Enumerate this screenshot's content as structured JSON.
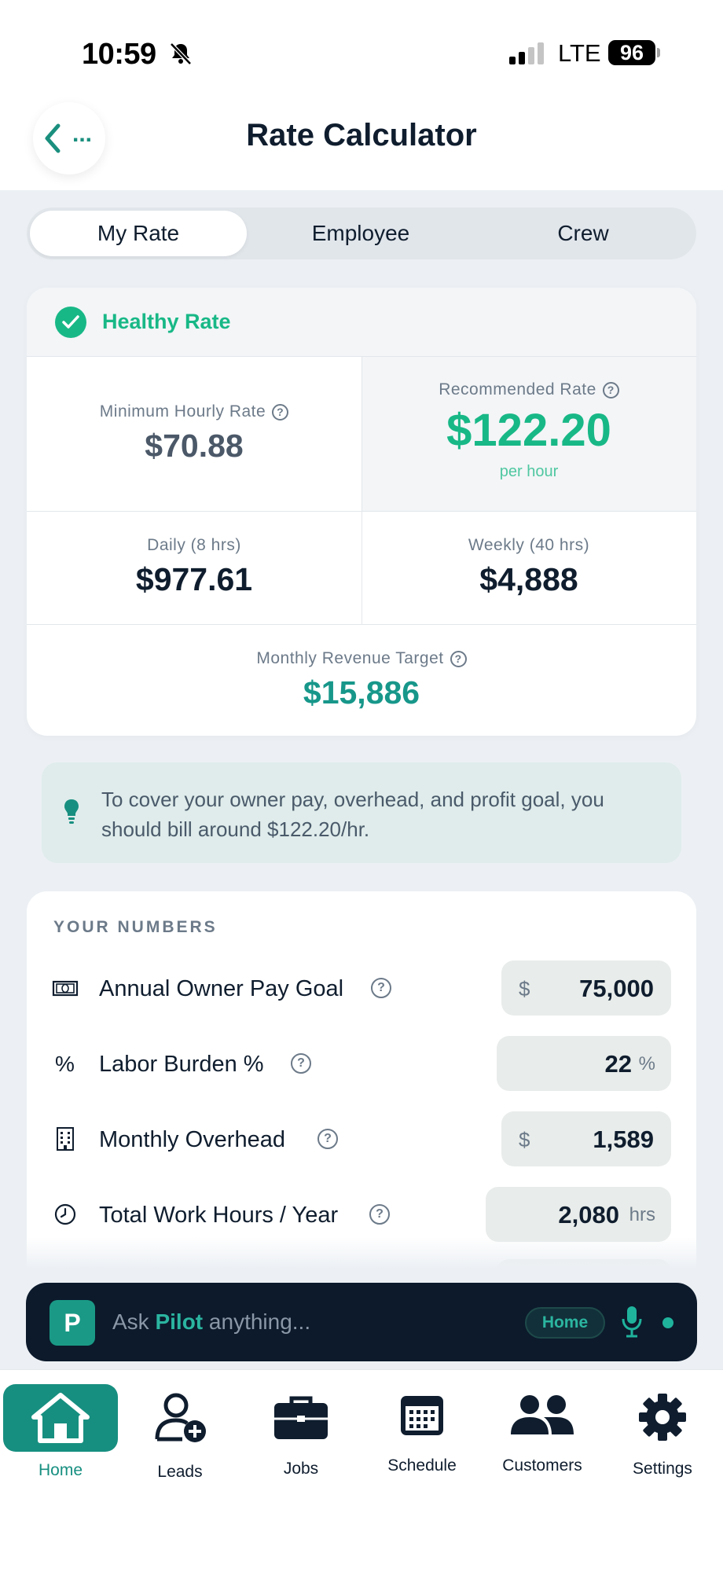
{
  "status_bar": {
    "time": "10:59",
    "network": "LTE",
    "battery": "96"
  },
  "header": {
    "back_label": "...",
    "title": "Rate Calculator"
  },
  "tabs": [
    {
      "label": "My Rate",
      "active": true
    },
    {
      "label": "Employee",
      "active": false
    },
    {
      "label": "Crew",
      "active": false
    }
  ],
  "rate_card": {
    "status": "Healthy Rate",
    "minimum_label": "Minimum Hourly Rate",
    "minimum_value": "$70.88",
    "recommended_label": "Recommended Rate",
    "recommended_value": "$122.20",
    "recommended_unit": "per hour",
    "daily_label": "Daily (8 hrs)",
    "daily_value": "$977.61",
    "weekly_label": "Weekly (40 hrs)",
    "weekly_value": "$4,888",
    "monthly_label": "Monthly Revenue Target",
    "monthly_value": "$15,886"
  },
  "tip": {
    "text": "To cover your owner pay, overhead, and profit goal, you should bill around $122.20/hr."
  },
  "numbers": {
    "title": "YOUR NUMBERS",
    "rows": [
      {
        "icon": "cash-icon",
        "label": "Annual Owner Pay Goal",
        "prefix": "$",
        "value": "75,000",
        "suffix": ""
      },
      {
        "icon": "percent-icon",
        "label": "Labor Burden %",
        "prefix": "",
        "value": "22",
        "suffix": "%"
      },
      {
        "icon": "building-icon",
        "label": "Monthly Overhead",
        "prefix": "$",
        "value": "1,589",
        "suffix": ""
      },
      {
        "icon": "clock-icon",
        "label": "Total Work Hours / Year",
        "prefix": "",
        "value": "2,080",
        "suffix": "hrs"
      }
    ]
  },
  "pilot": {
    "logo": "P",
    "prompt_before": "Ask ",
    "prompt_brand": "Pilot",
    "prompt_after": " anything...",
    "chip": "Home"
  },
  "tab_bar": [
    {
      "icon": "home-icon",
      "label": "Home",
      "active": true
    },
    {
      "icon": "leads-icon",
      "label": "Leads",
      "active": false
    },
    {
      "icon": "briefcase-icon",
      "label": "Jobs",
      "active": false
    },
    {
      "icon": "calendar-icon",
      "label": "Schedule",
      "active": false
    },
    {
      "icon": "customers-icon",
      "label": "Customers",
      "active": false
    },
    {
      "icon": "gear-icon",
      "label": "Settings",
      "active": false
    }
  ],
  "colors": {
    "accent": "#18b886",
    "teal": "#178f80",
    "navy": "#0c1a2c"
  }
}
